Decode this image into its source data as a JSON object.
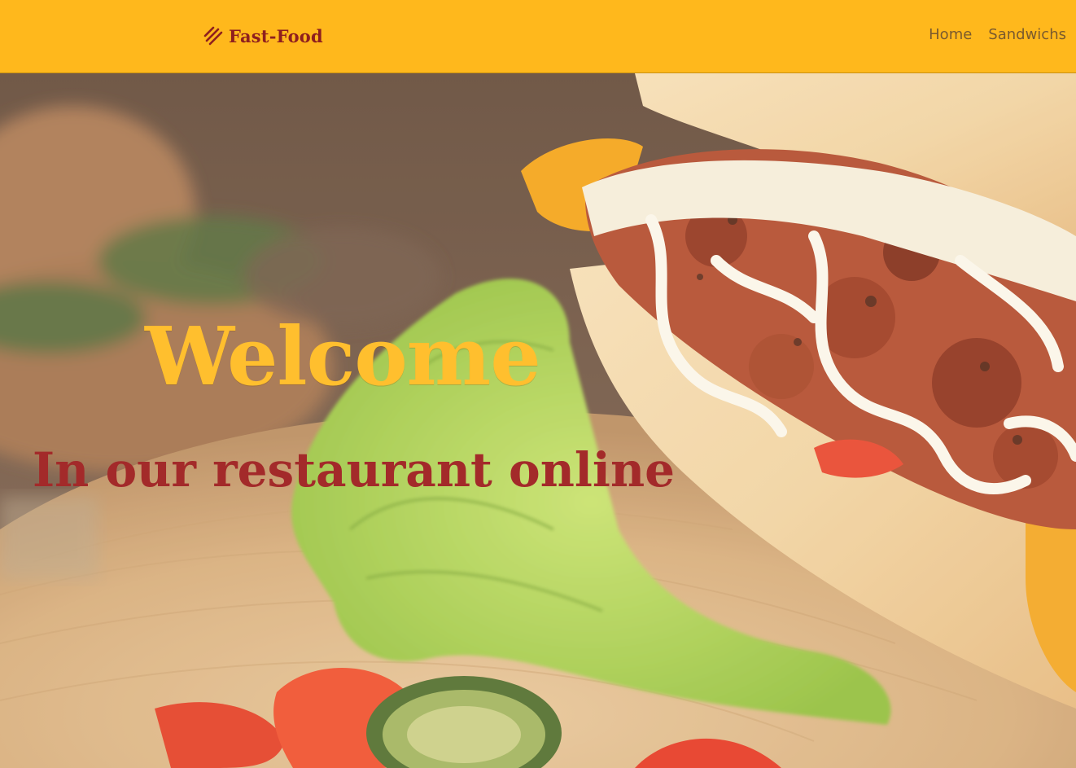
{
  "navbar": {
    "brand_text": "Fast-Food",
    "brand_icon": "hotdog-stripes-icon",
    "links": [
      {
        "label": "Home"
      },
      {
        "label": "Sandwichs"
      }
    ]
  },
  "hero": {
    "headline": "Welcome",
    "subheadline": "In our restaurant online",
    "image_subject": "sandwich-photo"
  },
  "colors": {
    "navbar_bg": "#ffb81c",
    "brand": "#8e1f1f",
    "headline": "#ffbf2e",
    "subheadline": "#a32a2a"
  }
}
